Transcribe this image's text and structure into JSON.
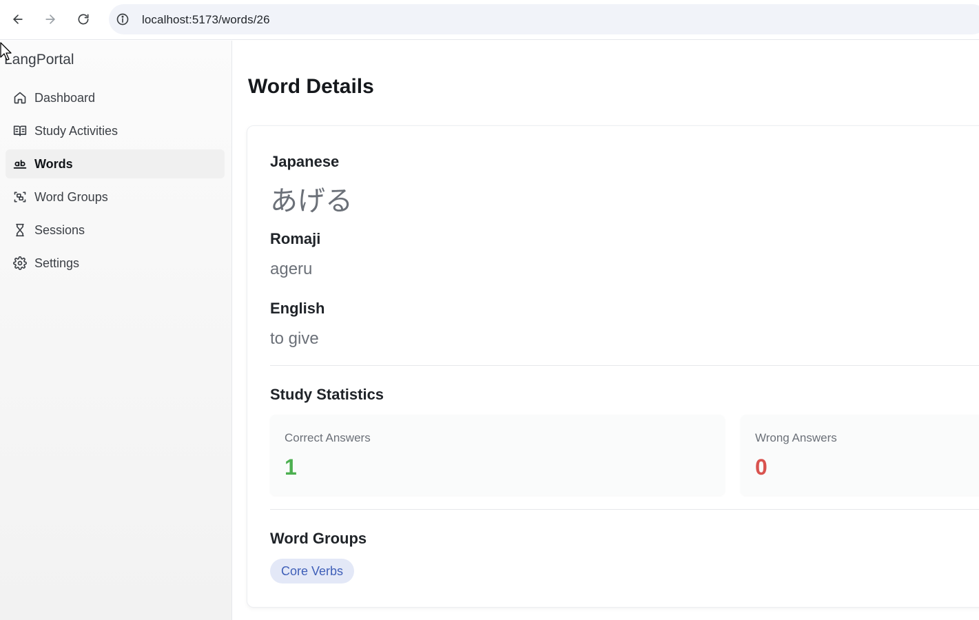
{
  "browser": {
    "url": "localhost:5173/words/26"
  },
  "sidebar": {
    "brand": "LangPortal",
    "items": [
      {
        "label": "Dashboard",
        "icon": "home-icon",
        "active": false
      },
      {
        "label": "Study Activities",
        "icon": "book-open-icon",
        "active": false
      },
      {
        "label": "Words",
        "icon": "whole-word-icon",
        "active": true
      },
      {
        "label": "Word Groups",
        "icon": "group-icon",
        "active": false
      },
      {
        "label": "Sessions",
        "icon": "hourglass-icon",
        "active": false
      },
      {
        "label": "Settings",
        "icon": "gear-icon",
        "active": false
      }
    ]
  },
  "main": {
    "title": "Word Details",
    "word": {
      "japanese_label": "Japanese",
      "japanese": "あげる",
      "romaji_label": "Romaji",
      "romaji": "ageru",
      "english_label": "English",
      "english": "to give"
    },
    "stats": {
      "title": "Study Statistics",
      "correct_label": "Correct Answers",
      "correct": "1",
      "wrong_label": "Wrong Answers",
      "wrong": "0"
    },
    "groups": {
      "title": "Word Groups",
      "items": [
        "Core Verbs"
      ]
    }
  },
  "colors": {
    "correct": "#4caf50",
    "wrong": "#d9534f",
    "chip_bg": "#e3e8f7",
    "chip_text": "#3f5fb8"
  }
}
